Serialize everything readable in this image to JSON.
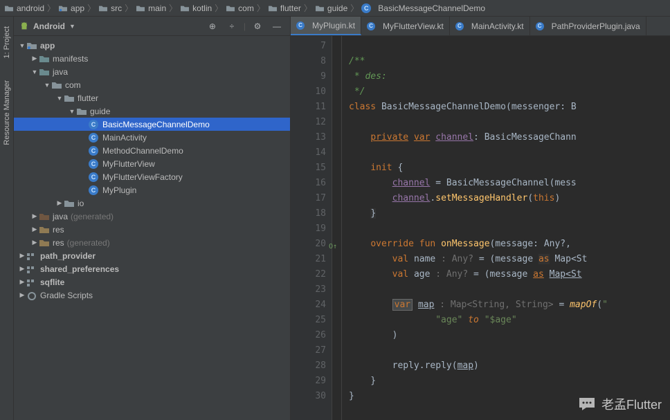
{
  "breadcrumbs": [
    "android",
    "app",
    "src",
    "main",
    "kotlin",
    "com",
    "flutter",
    "guide",
    "BasicMessageChannelDemo"
  ],
  "project": {
    "header_label": "Android"
  },
  "tree": {
    "app": "app",
    "manifests": "manifests",
    "java": "java",
    "com": "com",
    "flutter": "flutter",
    "guide": "guide",
    "cls_basic": "BasicMessageChannelDemo",
    "cls_main": "MainActivity",
    "cls_method": "MethodChannelDemo",
    "cls_view": "MyFlutterView",
    "cls_factory": "MyFlutterViewFactory",
    "cls_plugin": "MyPlugin",
    "io": "io",
    "java_gen": "java",
    "gen_suffix": "(generated)",
    "res": "res",
    "res_gen": "res",
    "path_provider": "path_provider",
    "shared_prefs": "shared_preferences",
    "sqflite": "sqflite",
    "gradle": "Gradle Scripts"
  },
  "side_tabs": {
    "project": "1: Project",
    "resource": "Resource Manager"
  },
  "tabs": [
    {
      "label": "MyPlugin.kt"
    },
    {
      "label": "MyFlutterView.kt"
    },
    {
      "label": "MainActivity.kt"
    },
    {
      "label": "PathProviderPlugin.java"
    }
  ],
  "code": {
    "lines": [
      7,
      8,
      9,
      10,
      11,
      12,
      13,
      14,
      15,
      16,
      17,
      18,
      19,
      20,
      21,
      22,
      23,
      24,
      25,
      26,
      27,
      28,
      29,
      30
    ],
    "l8": "/**",
    "l9": " * des:",
    "l10": " */",
    "l11_kw": "class",
    "l11_name": "BasicMessageChannelDemo",
    "l11_param": "messenger",
    "l13_priv": "private",
    "l13_var": "var",
    "l13_field": "channel",
    "l13_type": "BasicMessageChann",
    "l15_init": "init",
    "l16_field": "channel",
    "l16_rhs": "BasicMessageChannel(mess",
    "l17_field": "channel",
    "l17_method": "setMessageHandler",
    "l17_this": "this",
    "l20_override": "override",
    "l20_fun": "fun",
    "l20_name": "onMessage",
    "l20_param": "message",
    "l20_type": "Any?",
    "l21_val": "val",
    "l21_name": "name",
    "l21_hint": ": Any?",
    "l21_msg": "message",
    "l21_as": "as",
    "l21_map": "Map<St",
    "l22_val": "val",
    "l22_name": "age",
    "l22_hint": ": Any?",
    "l22_msg": "message",
    "l22_as": "as",
    "l22_map": "Map<St",
    "l24_var": "var",
    "l24_name": "map",
    "l24_hint": ": Map<String, String>",
    "l24_fn": "mapOf",
    "l25_key": "\"age\"",
    "l25_to": "to",
    "l25_val": "\"$age\"",
    "l28_reply": "reply",
    "l28_method": "reply",
    "l28_arg": "map"
  },
  "watermark": "老孟Flutter"
}
